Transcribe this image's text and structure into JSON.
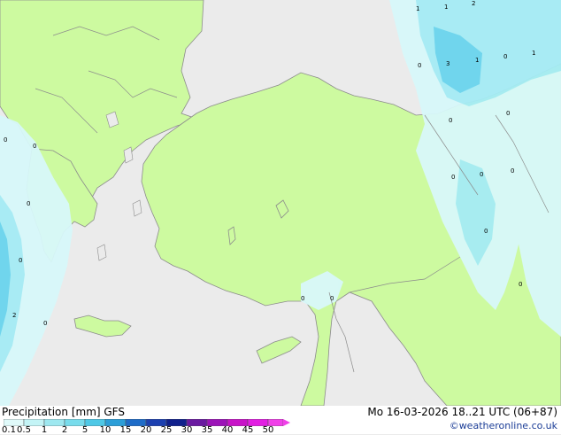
{
  "map": {
    "colors": {
      "sea": "#ebebeb",
      "land": "#cdfaa0",
      "precip_light": "#d8f8fa",
      "precip_mid": "#a5ecf5",
      "precip_heavy": "#6ad4ee",
      "precip_max": "#3cbde6",
      "border": "#8c8c8c"
    },
    "labels": [
      "1",
      "1",
      "2",
      "0",
      "3",
      "1",
      "0",
      "1",
      "0",
      "0",
      "0",
      "0",
      "0",
      "0",
      "0",
      "0",
      "0",
      "0",
      "0",
      "0",
      "0",
      "2",
      "0",
      "0"
    ]
  },
  "footer": {
    "title": "Precipitation [mm]  GFS",
    "valid": "Mo 16-03-2026  18..21 UTC (06+87)",
    "credit": "©weatheronline.co.uk",
    "scale_labels": [
      "0.1",
      "0.5",
      "1",
      "2",
      "5",
      "10",
      "15",
      "20",
      "25",
      "30",
      "35",
      "40",
      "45",
      "50"
    ],
    "scale_colors": [
      "#e0fafa",
      "#c4f4f6",
      "#9ee8f0",
      "#78dcec",
      "#4ec8e6",
      "#2c9ed8",
      "#1e6cc8",
      "#1c40b0",
      "#10208c",
      "#6a1aa0",
      "#9c14b8",
      "#c814c8",
      "#e21ee2",
      "#f040e8"
    ]
  }
}
